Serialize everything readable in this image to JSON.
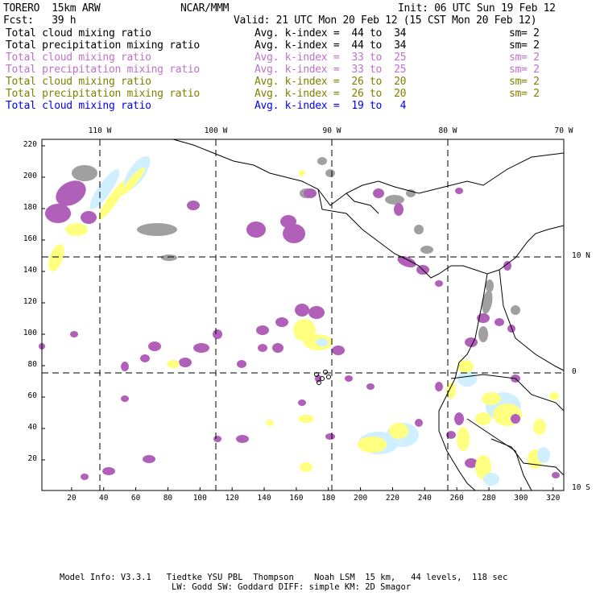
{
  "header": {
    "model": "TORERO  15km ARW",
    "org": "NCAR/MMM",
    "init": "Init: 06 UTC Sun 19 Feb 12",
    "fcst": "Fcst:   39 h",
    "valid": "Valid: 21 UTC Mon 20 Feb 12 (15 CST Mon 20 Feb 12)"
  },
  "legend": [
    {
      "field": "Total cloud mixing ratio",
      "kindex": "Avg. k-index =  44 to  34",
      "sm": "sm= 2",
      "color": "#000000"
    },
    {
      "field": "Total precipitation mixing ratio",
      "kindex": "Avg. k-index =  44 to  34",
      "sm": "sm= 2",
      "color": "#000000"
    },
    {
      "field": "Total cloud mixing ratio",
      "kindex": "Avg. k-index =  33 to  25",
      "sm": "sm= 2",
      "color": "#c070c8"
    },
    {
      "field": "Total precipitation mixing ratio",
      "kindex": "Avg. k-index =  33 to  25",
      "sm": "sm= 2",
      "color": "#c070c8"
    },
    {
      "field": "Total cloud mixing ratio",
      "kindex": "Avg. k-index =  26 to  20",
      "sm": "sm= 2",
      "color": "#808000"
    },
    {
      "field": "Total precipitation mixing ratio",
      "kindex": "Avg. k-index =  26 to  20",
      "sm": "sm= 2",
      "color": "#808000"
    },
    {
      "field": "Total cloud mixing ratio",
      "kindex": "Avg. k-index =  19 to   4",
      "sm": "",
      "color": "#0000ff"
    }
  ],
  "map": {
    "lon_labels": [
      "110 W",
      "100 W",
      "90 W",
      "80 W",
      "70 W"
    ],
    "lat_labels": [
      "10 N",
      "0",
      "10 S"
    ],
    "x_ticks": [
      "20",
      "40",
      "60",
      "80",
      "100",
      "120",
      "140",
      "160",
      "180",
      "200",
      "220",
      "240",
      "260",
      "280",
      "300",
      "320"
    ],
    "y_ticks": [
      "220",
      "200",
      "180",
      "160",
      "140",
      "120",
      "100",
      "80",
      "60",
      "40",
      "20"
    ],
    "colors": {
      "gray": "#a0a0a0",
      "purple": "#b060b8",
      "yellow": "#ffff80",
      "cyan": "#d0f0ff"
    }
  },
  "footer": {
    "line1": "Model Info: V3.3.1   Tiedtke YSU PBL  Thompson    Noah LSM  15 km,   44 levels,  118 sec",
    "line2": "LW: Godd SW: Goddard DIFF: simple KM: 2D Smagor"
  }
}
